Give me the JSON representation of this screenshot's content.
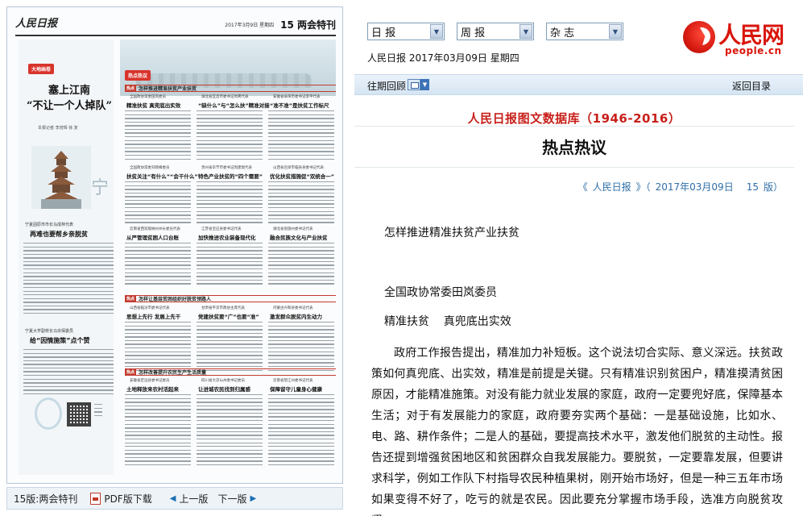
{
  "paper": {
    "masthead": "人民日报",
    "date_line": "2017年3月9日 星期四",
    "edition": "15 两会特刊",
    "left_tag": "大地画卷",
    "left_headline_1": "塞上江南",
    "left_headline_2": "“不让一个人掉队”",
    "left_byline": "本报记者 李增辉 徐 复",
    "sub_story_1_kicker": "宁夏固原市市长马成林代表",
    "sub_story_1_head": "再难也要帮乡亲脱贫",
    "sub_story_2_kicker": "宁夏大学副校长马宗保委员",
    "sub_story_2_head": "给“因情施策”点个赞",
    "hot_tag": "热点热议",
    "section_1": "怎样推进精准扶贫产业扶贫",
    "section_2": "怎样让基层贫困组织好脱贫领路人",
    "section_3": "怎样改善提升农民生产生活质量",
    "articles": [
      {
        "kicker": "全国政协常委田岚委员",
        "head": "精准扶贫 真兜底出实效"
      },
      {
        "kicker": "湖北省宜昌市委书记周霁代表",
        "head": "“缺什么”与“怎么扶”精准对接"
      },
      {
        "kicker": "安徽省阜阳市委书记李平代表",
        "head": "“准不准”是扶贫工作标尺"
      },
      {
        "kicker": "全国政协常委刘晓峰委员",
        "head": "扶贫关注“有什么”“会干什么”"
      },
      {
        "kicker": "贵州省毕节市委书记周建琨代表",
        "head": "特色产业扶贫的“四个需要”"
      },
      {
        "kicker": "山西省吕梁市临县县委书记代表",
        "head": "优化扶贫措施促“双统合一”"
      },
      {
        "kicker": "云南省西双版纳州州长委员代表",
        "head": "从严管理贫困人口台账"
      },
      {
        "kicker": "江苏省宝应县委书记代表",
        "head": "加快推进农业装备现代化"
      },
      {
        "kicker": "湖北省恩施州委书记代表",
        "head": "融合民族文化与产业扶贫"
      },
      {
        "kicker": "山西省临汾市委书记代表",
        "head": "思想上先行 发展上先干"
      },
      {
        "kicker": "甘肃省平凉市政协主席代表",
        "head": "党建扶贫要“广”也要“准”"
      },
      {
        "kicker": "内蒙古兴和县委书记代表",
        "head": "激发群众脱贫内生动力"
      },
      {
        "kicker": "安徽省定远县委书记委员",
        "head": "土地释放来农村活起来"
      },
      {
        "kicker": "四川省大凉山州委书记委员",
        "head": "让进城农民找到归属感"
      },
      {
        "kicker": "云南省怒江州委书记代表",
        "head": "保障留守儿童身心健康"
      }
    ]
  },
  "toolbar": {
    "edition_label": "15版:两会特刊",
    "pdf_label": "PDF版下载",
    "prev_label": "上一版",
    "next_label": "下一版"
  },
  "header": {
    "select_daily": "日  报",
    "select_weekly": "周  报",
    "select_magazine": "杂  志",
    "date_line": "人民日报  2017年03月09日  星期四",
    "logo_cn": "人民网",
    "logo_en": "people.cn"
  },
  "nav": {
    "back_label": "往期回顾",
    "return_label": "返回目录"
  },
  "article": {
    "database_title": "人民日报图文数据库（1946-2016）",
    "column_title": "热点热议",
    "source_prefix": "《",
    "source_paper": "人民日报",
    "source_suffix": "》（",
    "source_date": "2017年03月09日",
    "source_page": "15",
    "source_page_suffix": "版）",
    "headline": "怎样推进精准扶贫产业扶贫",
    "author": "全国政协常委田岚委员",
    "subhead": "精准扶贫    真兜底出实效",
    "body": "政府工作报告提出，精准加力补短板。这个说法切合实际、意义深远。扶贫政策如何真兜底、出实效，精准是前提是关键。只有精准识别贫困户，精准摸清贫困原因，才能精准施策。对没有能力就业发展的家庭，政府一定要兜好底，保障基本生活；对于有发展能力的家庭，政府要夯实两个基础：一是基础设施，比如水、电、路、耕作条件；二是人的基础，要提高技术水平，激发他们脱贫的主动性。报告还提到增强贫困地区和贫困群众自我发展能力。要脱贫，一定要靠发展，但要讲求科学，例如工作队下村指导农民种植果树，刚开始市场好，但是一种三五年市场如果变得不好了，吃亏的就是农民。因此要充分掌握市场手段，选准方向脱贫攻坚。"
  },
  "colors": {
    "accent_red": "#c8201a",
    "link_blue": "#2f6fa8",
    "nav_bg": "#d6e5f3"
  }
}
